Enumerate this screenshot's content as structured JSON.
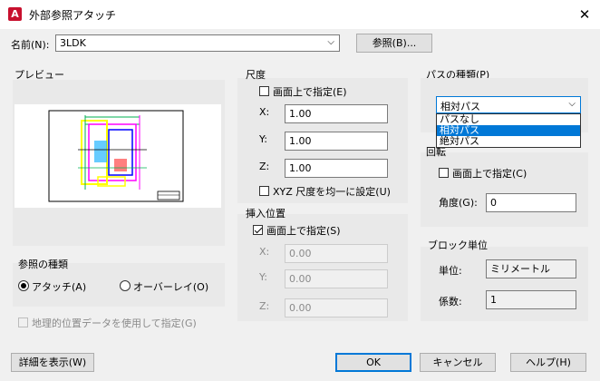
{
  "window": {
    "title": "外部参照アタッチ",
    "app_icon_letter": "A",
    "close_glyph": "✕"
  },
  "name_row": {
    "label": "名前(N):",
    "value": "3LDK",
    "browse_button": "参照(B)..."
  },
  "preview": {
    "label": "プレビュー"
  },
  "scale": {
    "label": "尺度",
    "specify_on_screen": "画面上で指定(E)",
    "x_label": "X:",
    "x_value": "1.00",
    "y_label": "Y:",
    "y_value": "1.00",
    "z_label": "Z:",
    "z_value": "1.00",
    "uniform": "XYZ 尺度を均一に設定(U)"
  },
  "insertion": {
    "label": "挿入位置",
    "specify_on_screen": "画面上で指定(S)",
    "x_label": "X:",
    "x_value": "0.00",
    "y_label": "Y:",
    "y_value": "0.00",
    "z_label": "Z:",
    "z_value": "0.00"
  },
  "path_type": {
    "label": "パスの種類(P)",
    "selected": "相対パス",
    "options": [
      "パスなし",
      "相対パス",
      "絶対パス"
    ]
  },
  "rotation": {
    "label_partial": "回転",
    "specify_on_screen": "画面上で指定(C)",
    "angle_label": "角度(G):",
    "angle_value": "0"
  },
  "block_unit": {
    "label": "ブロック単位",
    "unit_label": "単位:",
    "unit_value": "ミリメートル",
    "factor_label": "係数:",
    "factor_value": "1"
  },
  "reference_type": {
    "label": "参照の種類",
    "attach": "アタッチ(A)",
    "overlay": "オーバーレイ(O)"
  },
  "geo": {
    "label": "地理的位置データを使用して指定(G)"
  },
  "buttons": {
    "details": "詳細を表示(W)",
    "ok": "OK",
    "cancel": "キャンセル",
    "help": "ヘルプ(H)"
  },
  "colors": {
    "accent": "#0078d7",
    "app_icon": "#c8102e"
  }
}
